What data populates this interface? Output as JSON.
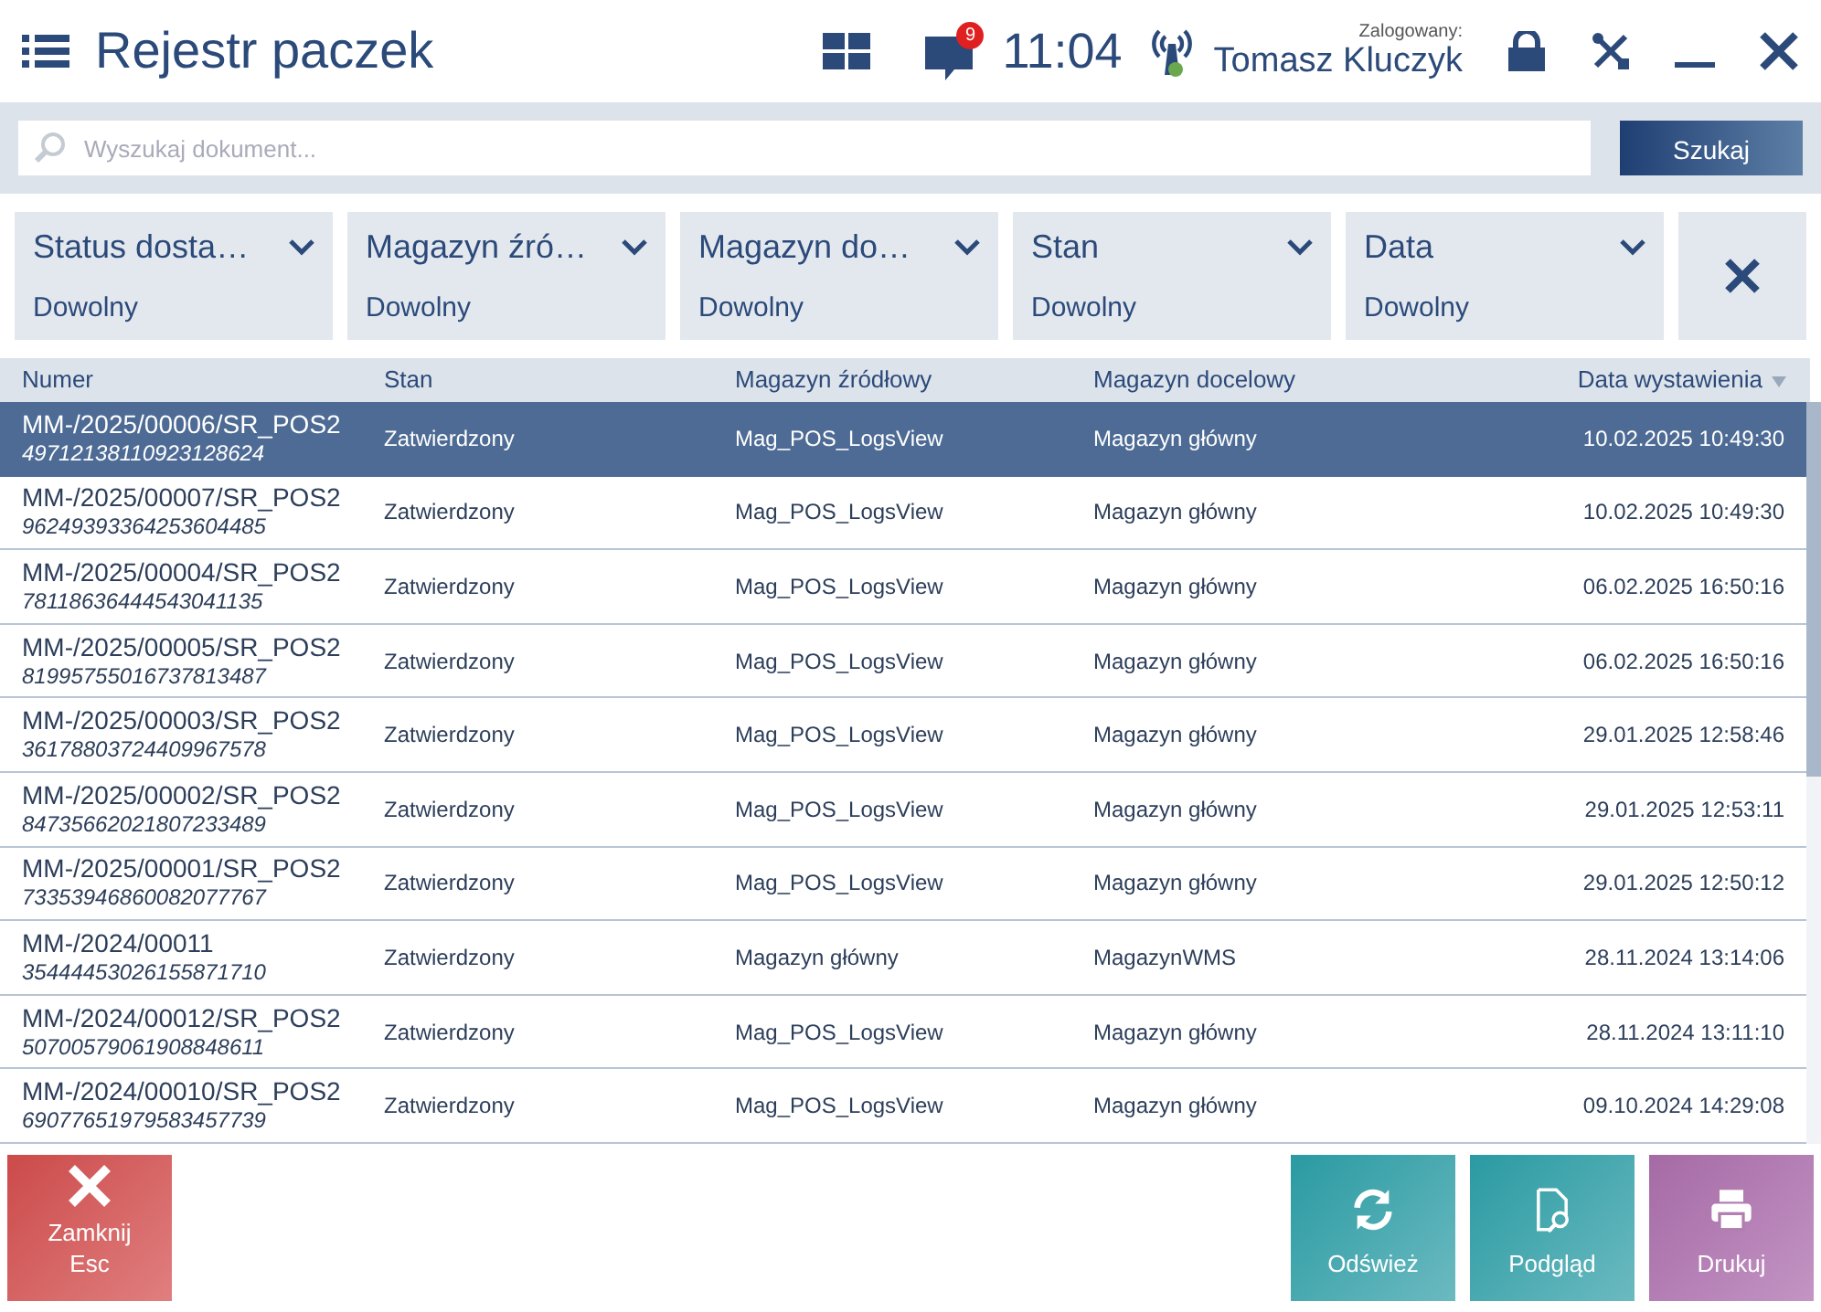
{
  "header": {
    "title": "Rejestr paczek",
    "notifications": "9",
    "time": "11:04",
    "logged_label": "Zalogowany:",
    "user": "Tomasz Kluczyk"
  },
  "search": {
    "placeholder": "Wyszukaj dokument...",
    "button": "Szukaj"
  },
  "filters": [
    {
      "label": "Status dosta…",
      "value": "Dowolny"
    },
    {
      "label": "Magazyn źró…",
      "value": "Dowolny"
    },
    {
      "label": "Magazyn do…",
      "value": "Dowolny"
    },
    {
      "label": "Stan",
      "value": "Dowolny"
    },
    {
      "label": "Data",
      "value": "Dowolny"
    }
  ],
  "table": {
    "columns": [
      "Numer",
      "Stan",
      "Magazyn źródłowy",
      "Magazyn docelowy",
      "Data wystawienia"
    ],
    "rows": [
      {
        "number": "MM-/2025/00006/SR_POS2",
        "code": "49712138110923128624",
        "state": "Zatwierdzony",
        "source": "Mag_POS_LogsView",
        "target": "Magazyn główny",
        "date": "10.02.2025 10:49:30",
        "selected": true
      },
      {
        "number": "MM-/2025/00007/SR_POS2",
        "code": "96249393364253604485",
        "state": "Zatwierdzony",
        "source": "Mag_POS_LogsView",
        "target": "Magazyn główny",
        "date": "10.02.2025 10:49:30",
        "selected": false
      },
      {
        "number": "MM-/2025/00004/SR_POS2",
        "code": "78118636444543041135",
        "state": "Zatwierdzony",
        "source": "Mag_POS_LogsView",
        "target": "Magazyn główny",
        "date": "06.02.2025 16:50:16",
        "selected": false
      },
      {
        "number": "MM-/2025/00005/SR_POS2",
        "code": "81995755016737813487",
        "state": "Zatwierdzony",
        "source": "Mag_POS_LogsView",
        "target": "Magazyn główny",
        "date": "06.02.2025 16:50:16",
        "selected": false
      },
      {
        "number": "MM-/2025/00003/SR_POS2",
        "code": "36178803724409967578",
        "state": "Zatwierdzony",
        "source": "Mag_POS_LogsView",
        "target": "Magazyn główny",
        "date": "29.01.2025 12:58:46",
        "selected": false
      },
      {
        "number": "MM-/2025/00002/SR_POS2",
        "code": "84735662021807233489",
        "state": "Zatwierdzony",
        "source": "Mag_POS_LogsView",
        "target": "Magazyn główny",
        "date": "29.01.2025 12:53:11",
        "selected": false
      },
      {
        "number": "MM-/2025/00001/SR_POS2",
        "code": "73353946860082077767",
        "state": "Zatwierdzony",
        "source": "Mag_POS_LogsView",
        "target": "Magazyn główny",
        "date": "29.01.2025 12:50:12",
        "selected": false
      },
      {
        "number": "MM-/2024/00011",
        "code": "35444453026155871710",
        "state": "Zatwierdzony",
        "source": "Magazyn główny",
        "target": "MagazynWMS",
        "date": "28.11.2024 13:14:06",
        "selected": false
      },
      {
        "number": "MM-/2024/00012/SR_POS2",
        "code": "50700579061908848611",
        "state": "Zatwierdzony",
        "source": "Mag_POS_LogsView",
        "target": "Magazyn główny",
        "date": "28.11.2024 13:11:10",
        "selected": false
      },
      {
        "number": "MM-/2024/00010/SR_POS2",
        "code": "69077651979583457739",
        "state": "Zatwierdzony",
        "source": "Mag_POS_LogsView",
        "target": "Magazyn główny",
        "date": "09.10.2024 14:29:08",
        "selected": false
      }
    ]
  },
  "actions": [
    {
      "kind": "close",
      "label": "Zamknij",
      "shortcut": "Esc"
    },
    {
      "kind": "refresh",
      "label": "Odśwież"
    },
    {
      "kind": "preview",
      "label": "Podgląd"
    },
    {
      "kind": "print",
      "label": "Drukuj"
    }
  ]
}
